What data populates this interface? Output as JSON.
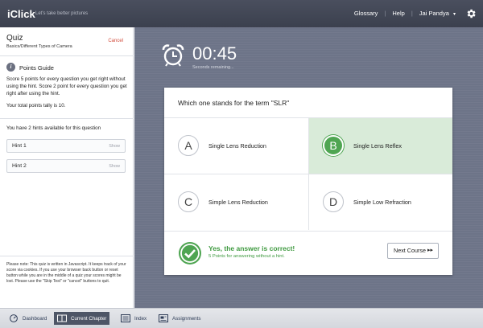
{
  "header": {
    "brand": "iClick",
    "tagline": "Let's take better pictures",
    "nav": [
      {
        "label": "Glossary"
      },
      {
        "label": "Help"
      },
      {
        "label": "Jai Pandya"
      }
    ],
    "caret": "▾",
    "separator": "|"
  },
  "sidebar": {
    "title": "Quiz",
    "subtitle": "Basics/Different Types of Camera",
    "cancel_label": "Cancel",
    "guide_title": "Points Guide",
    "guide_text": "Score 5 points for every question you get right without using the hint. Score 2 point for every question you get right after using the hint.",
    "tally": "Your total points tally is 10.",
    "hints_available": "You have 2 hints available for this question",
    "hints": [
      {
        "label": "Hint 1",
        "action": "Show"
      },
      {
        "label": "Hint 2",
        "action": "Show"
      }
    ],
    "note": "Please note: This quiz is written in Javascript. It keeps track of your score via cookies. If you use your browser back button or reset button while you are in the middle of a quiz your scores might be lost. Please use the \"Skip Test\" or \"cancel\" buttons to quit."
  },
  "timer": {
    "value": "00:45",
    "caption": "Seconds remaining..."
  },
  "quiz": {
    "question": "Which one stands for the term \"SLR\"",
    "options": [
      {
        "letter": "A",
        "text": "Single Lens Reduction",
        "selected": false
      },
      {
        "letter": "B",
        "text": "Single Lens Reflex",
        "selected": true
      },
      {
        "letter": "C",
        "text": "Simple Lens Reduction",
        "selected": false
      },
      {
        "letter": "D",
        "text": "Simple Low Refraction",
        "selected": false
      }
    ],
    "feedback_title": "Yes, the answer is correct!",
    "feedback_points": "5 Points for answering without a hint.",
    "next_label": "Next Course",
    "next_arrows": "▸▸"
  },
  "bottombar": {
    "items": [
      {
        "label": "Dashboard",
        "icon": "dashboard-icon"
      },
      {
        "label": "Current Chapter",
        "icon": "book-icon",
        "active": true
      },
      {
        "label": "Index",
        "icon": "index-icon"
      },
      {
        "label": "Assignments",
        "icon": "assignments-icon"
      }
    ]
  },
  "colors": {
    "accent_green": "#4fa552",
    "selected_bg": "#d9ebd9",
    "cancel_red": "#d14a3a",
    "main_bg": "#6d7488",
    "header_bg": "#434856"
  }
}
